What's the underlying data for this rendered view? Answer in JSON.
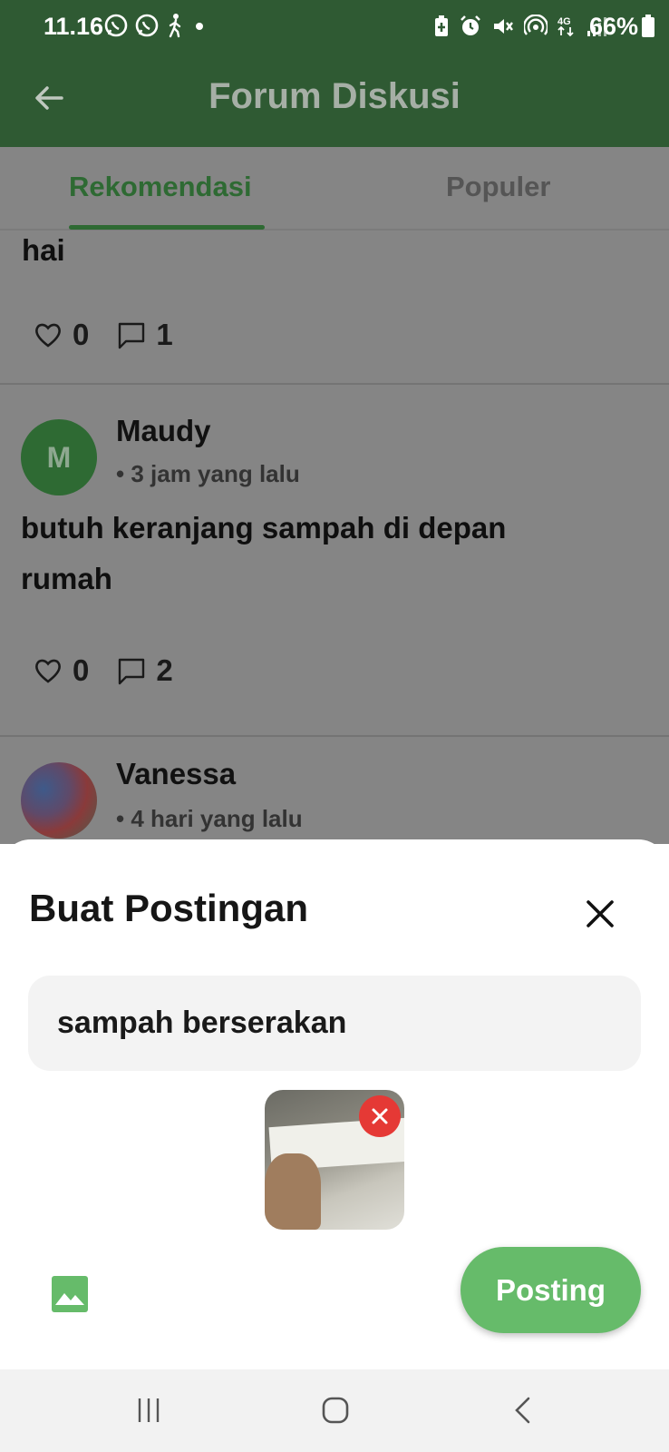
{
  "status_bar": {
    "time": "11.16",
    "battery": "66%",
    "left_icons": [
      "whatsapp-icon",
      "whatsapp-icon",
      "walking-icon",
      "dot-icon"
    ],
    "right_icons": [
      "battery-saver-icon",
      "alarm-icon",
      "mute-icon",
      "hotspot-icon",
      "4g-icon",
      "signal-icon"
    ]
  },
  "app_bar": {
    "title": "Forum Diskusi",
    "back_icon": "back-arrow-icon"
  },
  "tabs": [
    {
      "label": "Rekomendasi",
      "active": true
    },
    {
      "label": "Populer",
      "active": false
    }
  ],
  "feed": {
    "posts": [
      {
        "text": "hai",
        "likes": "0",
        "comments": "1"
      },
      {
        "author": "Maudy",
        "avatar_initial": "M",
        "time": "• 3 jam yang lalu",
        "text_line1": "butuh keranjang sampah di depan",
        "text_line2": "rumah",
        "likes": "0",
        "comments": "2"
      },
      {
        "author": "Vanessa",
        "time": "• 4 hari yang lalu"
      }
    ]
  },
  "sheet": {
    "title": "Buat Postingan",
    "input_value": "sampah berserakan",
    "post_button": "Posting"
  },
  "colors": {
    "primary_dark": "#2f5a33",
    "primary": "#2e6a33",
    "accent": "#66bb6a",
    "danger": "#e53935"
  }
}
